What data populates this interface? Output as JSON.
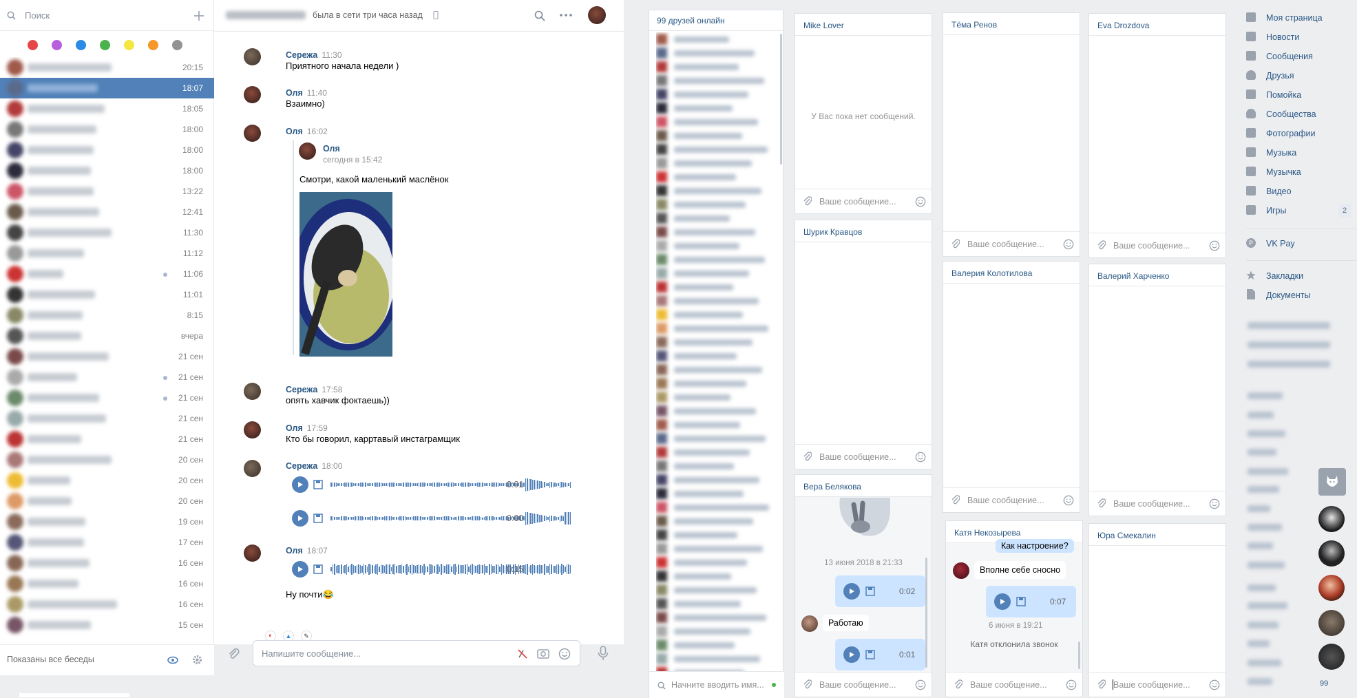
{
  "dialogs": {
    "search_placeholder": "Поиск",
    "color_tags": [
      "#e64646",
      "#b760de",
      "#2a8ae6",
      "#4bb34b",
      "#f5e642",
      "#f59829",
      "#939393"
    ],
    "times": [
      "20:15",
      "18:07",
      "18:05",
      "18:00",
      "18:00",
      "18:00",
      "13:22",
      "12:41",
      "11:30",
      "11:12",
      "11:06",
      "11:01",
      "8:15",
      "вчера",
      "21 сен",
      "21 сен",
      "21 сен",
      "21 сен",
      "21 сен",
      "20 сен",
      "20 сен",
      "20 сен",
      "19 сен",
      "17 сен",
      "16 сен",
      "16 сен",
      "16 сен",
      "15 сен"
    ],
    "footer_text": "Показаны все беседы"
  },
  "chat": {
    "status": "была в сети три часа назад",
    "messages": [
      {
        "author": "Сережа",
        "time": "11:30",
        "text": "Приятного начала недели )"
      },
      {
        "author": "Оля",
        "time": "11:40",
        "text": "Взаимно)"
      },
      {
        "author": "Оля",
        "time": "16:02",
        "fwd_author": "Оля",
        "fwd_time": "сегодня в 15:42",
        "fwd_text": "Смотри, какой маленький маслёнок"
      },
      {
        "author": "Сережа",
        "time": "17:58",
        "text": "опять хавчик фоктаешь))"
      },
      {
        "author": "Оля",
        "time": "17:59",
        "text": "Кто бы говорил, карртавый инстаграмщик"
      },
      {
        "author": "Сережа",
        "time": "18:00",
        "voice1": "0:01",
        "voice2": "0:00"
      },
      {
        "author": "Оля",
        "time": "18:07",
        "voice1": "0:15",
        "text": "Ну почти😂"
      }
    ],
    "input_placeholder": "Напишите сообщение..."
  },
  "friends": {
    "header": "99 друзей онлайн",
    "search_placeholder": "Начните вводить имя..."
  },
  "minichats": {
    "mike": {
      "name": "Mike Lover",
      "empty": "У Вас пока нет сообщений."
    },
    "tema": {
      "name": "Тёма Ренов"
    },
    "eva": {
      "name": "Eva Drozdova"
    },
    "shurik": {
      "name": "Шурик Кравцов"
    },
    "valeria": {
      "name": "Валерия Колотилова"
    },
    "valeriy": {
      "name": "Валерий Харченко"
    },
    "vera": {
      "name": "Вера Белякова",
      "date": "13 июня 2018 в 21:33",
      "voice1": "0:02",
      "reply": "Работаю",
      "voice2": "0:01"
    },
    "katya": {
      "name": "Катя Некозырева",
      "msg1": "Как настроение?",
      "msg2": "Вполне себе сносно",
      "voice": "0:07",
      "date": "6 июня в 19:21",
      "declined": "Катя отклонила звонок"
    },
    "yura": {
      "name": "Юра Смекалин"
    },
    "placeholder": "Ваше сообщение..."
  },
  "nav": {
    "items": [
      "Моя страница",
      "Новости",
      "Сообщения",
      "Друзья",
      "Помойка",
      "Сообщества",
      "Фотографии",
      "Музыка",
      "Музычка",
      "Видео",
      "Игры"
    ],
    "games_badge": "2",
    "vkpay": "VK Pay",
    "bookmarks": "Закладки",
    "documents": "Документы",
    "online_count": "99"
  }
}
